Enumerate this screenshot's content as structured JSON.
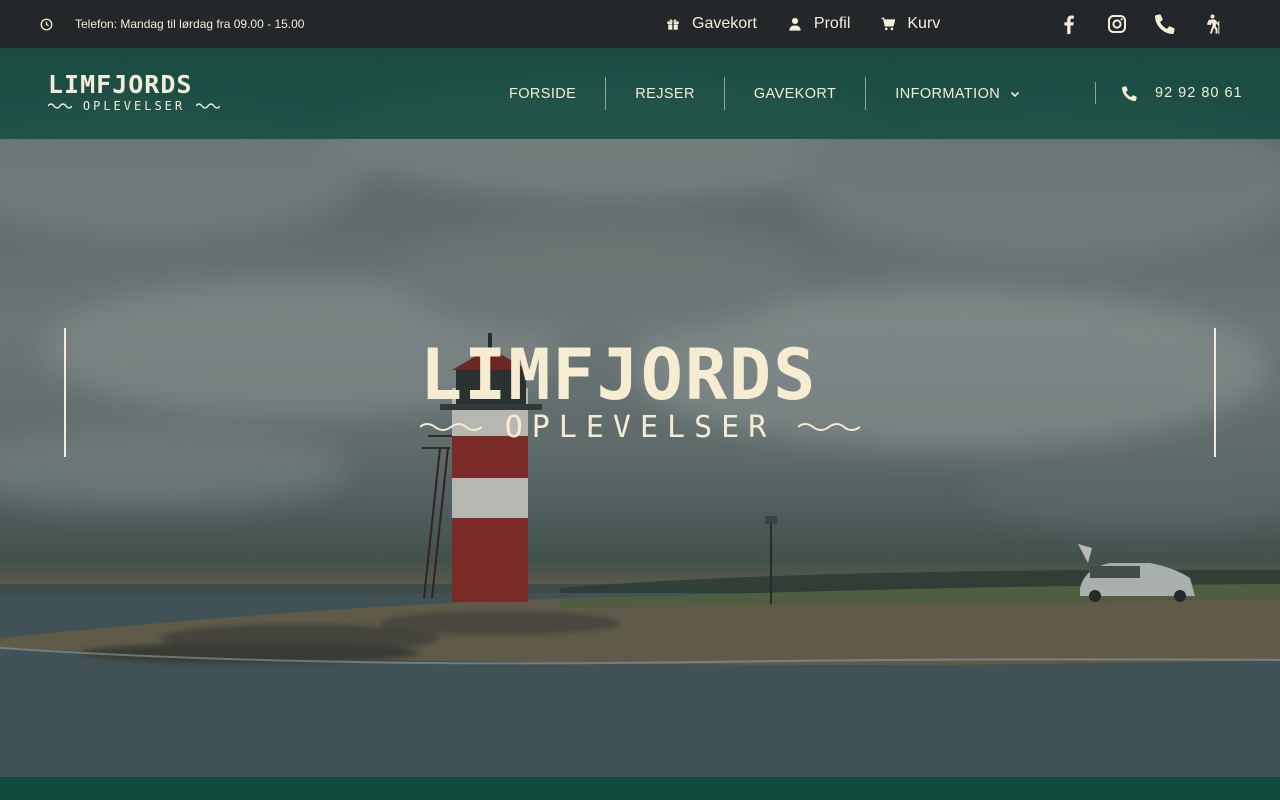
{
  "topbar": {
    "hours_text": "Telefon: Mandag til lørdag fra 09.00 - 15.00",
    "links": [
      {
        "label": "Gavekort",
        "icon": "gift-icon"
      },
      {
        "label": "Profil",
        "icon": "user-icon"
      },
      {
        "label": "Kurv",
        "icon": "cart-icon"
      }
    ],
    "social": [
      "facebook-icon",
      "instagram-icon",
      "phone-icon",
      "hiker-icon"
    ]
  },
  "header": {
    "logo_main": "LIMFJORDS",
    "logo_sub": "OPLEVELSER",
    "nav": [
      {
        "label": "FORSIDE"
      },
      {
        "label": "REJSER"
      },
      {
        "label": "GAVEKORT"
      },
      {
        "label": "INFORMATION",
        "has_dropdown": true
      }
    ],
    "phone": "92 92 80 61"
  },
  "hero": {
    "title_main": "LIMFJORDS",
    "title_sub": "OPLEVELSER"
  },
  "colors": {
    "topbar_bg": "#23272a",
    "header_bg": "#104a3e",
    "cream": "#f3ecd6",
    "footer_green": "#0f4a3c"
  }
}
